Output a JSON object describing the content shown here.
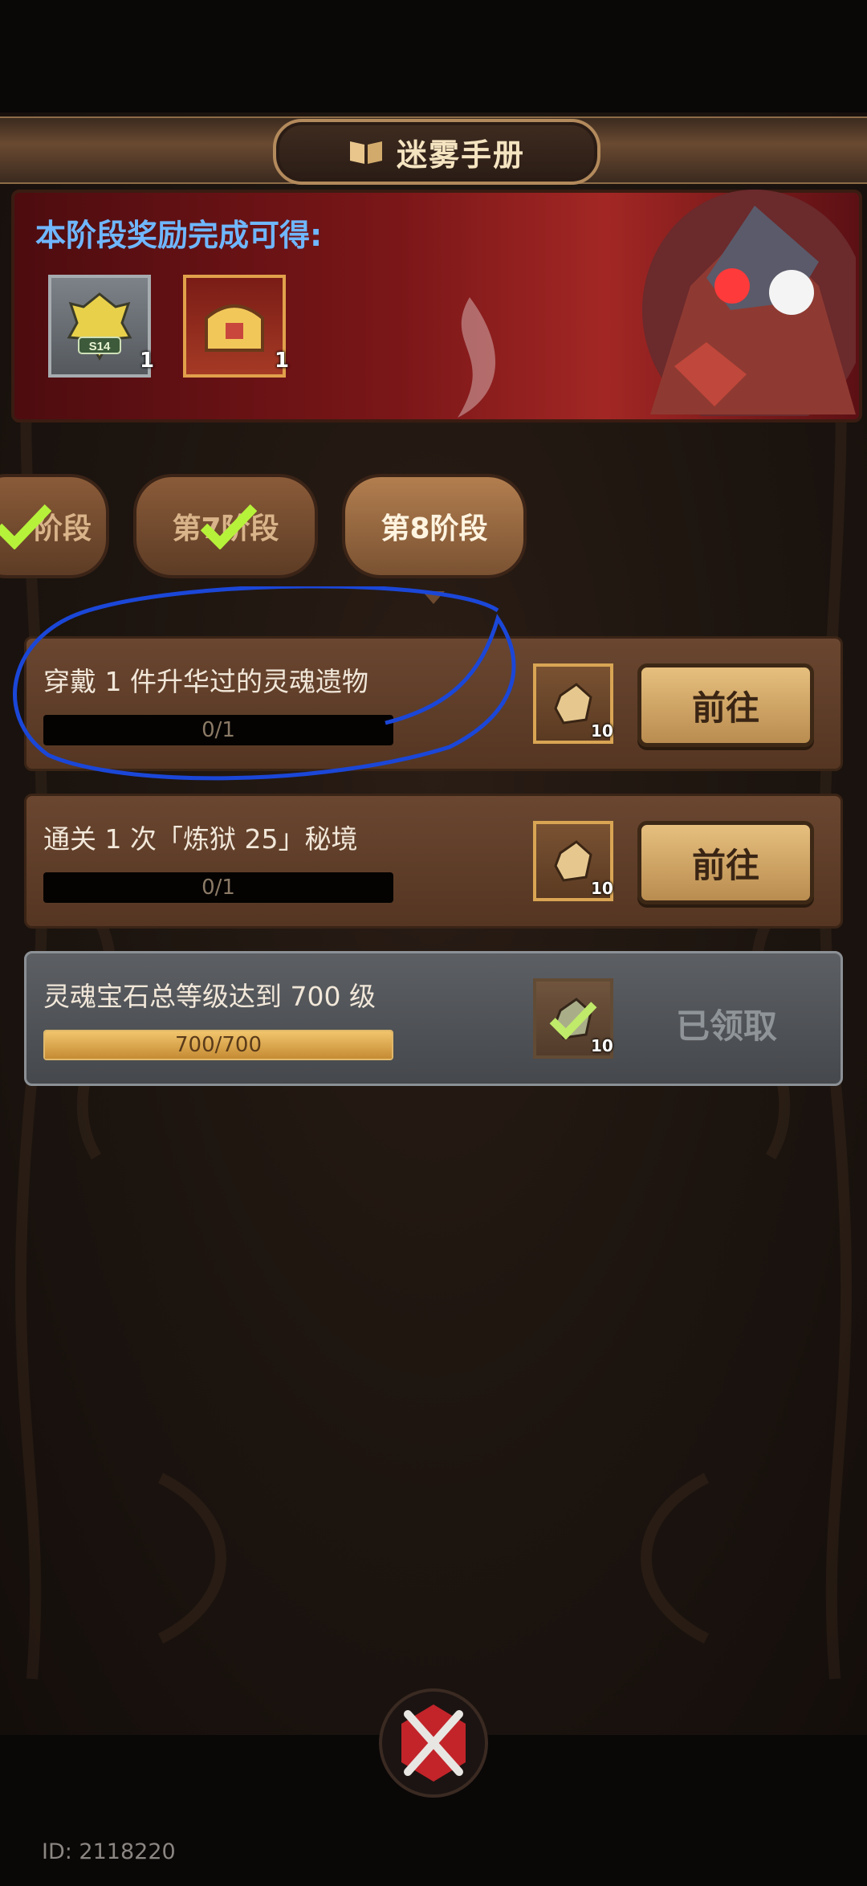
{
  "header": {
    "title": "迷雾手册",
    "icon": "book-icon"
  },
  "banner": {
    "title": "本阶段奖励完成可得:",
    "rewards": [
      {
        "icon": "s14-badge-icon",
        "badge_text": "S14",
        "count": "1"
      },
      {
        "icon": "treasure-chest-icon",
        "count": "1"
      }
    ]
  },
  "stages": {
    "tabs": [
      {
        "label": "阶段",
        "completed": true
      },
      {
        "label": "第7阶段",
        "completed": true
      },
      {
        "label": "第8阶段",
        "completed": false,
        "selected": true
      }
    ]
  },
  "tasks": [
    {
      "label": "穿戴 1 件升华过的灵魂遗物",
      "progress_text": "0/1",
      "progress": 0,
      "reward_icon": "ore-icon",
      "reward_count": "10",
      "button": "前往",
      "done": false
    },
    {
      "label": "通关 1 次「炼狱 25」秘境",
      "progress_text": "0/1",
      "progress": 0,
      "reward_icon": "ore-icon",
      "reward_count": "10",
      "button": "前往",
      "done": false
    },
    {
      "label": "灵魂宝石总等级达到 700 级",
      "progress_text": "700/700",
      "progress": 1,
      "reward_icon": "ore-icon",
      "reward_count": "10",
      "button": "已领取",
      "done": true
    }
  ],
  "footer": {
    "id_text": "ID: 2118220",
    "close_icon": "crossed-swords-icon"
  },
  "colors": {
    "accent": "#6fb7ff",
    "gold": "#d9a554",
    "annotation": "#1b47d8"
  }
}
